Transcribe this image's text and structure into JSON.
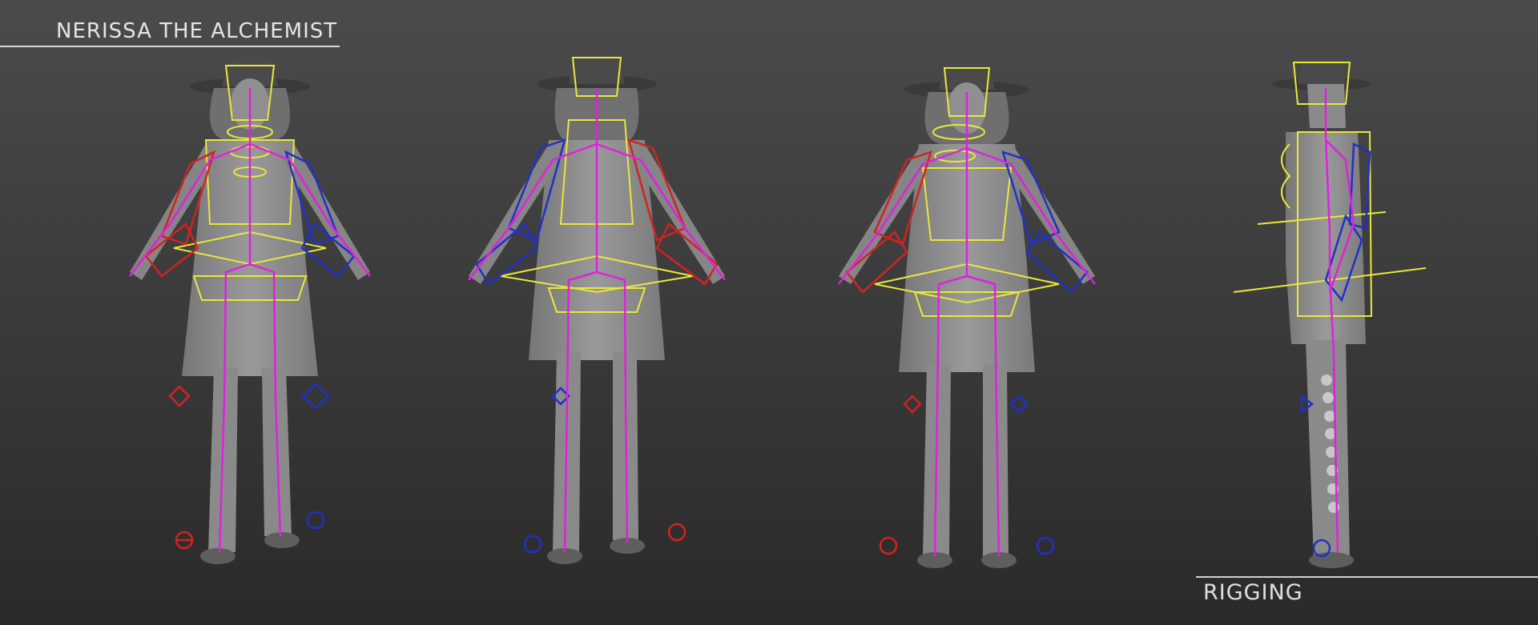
{
  "header": {
    "title": "NERISSA THE ALCHEMIST"
  },
  "footer": {
    "caption": "RIGGING"
  },
  "colors": {
    "model": "#8c8c8c",
    "model_dark": "#6e6e6e",
    "bones": "#e020e0",
    "controls_center": "#e8e83a",
    "controls_left": "#2230c8",
    "controls_right": "#d42222"
  },
  "views": [
    {
      "name": "front-left",
      "facing": "front"
    },
    {
      "name": "back",
      "facing": "back"
    },
    {
      "name": "front",
      "facing": "front"
    },
    {
      "name": "side",
      "facing": "side"
    }
  ]
}
